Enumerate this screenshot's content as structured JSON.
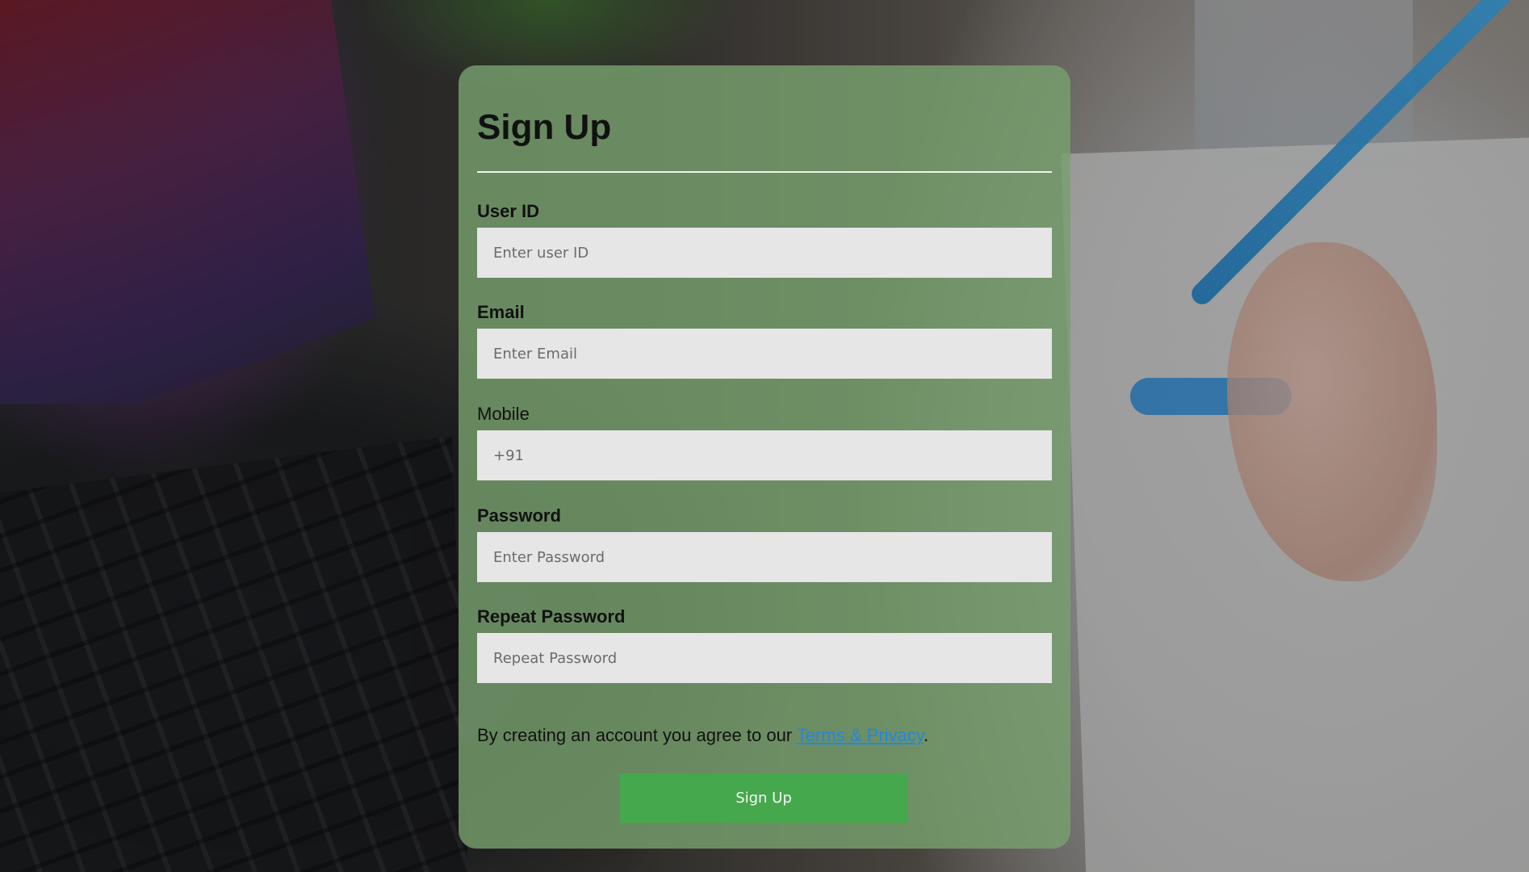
{
  "form": {
    "title": "Sign Up",
    "fields": [
      {
        "label": "User ID",
        "placeholder": "Enter user ID",
        "value": ""
      },
      {
        "label": "Email",
        "placeholder": "Enter Email",
        "value": ""
      },
      {
        "label": "Mobile",
        "placeholder": "+91",
        "value": ""
      },
      {
        "label": "Password",
        "placeholder": "Enter Password",
        "value": ""
      },
      {
        "label": "Repeat Password",
        "placeholder": "Repeat Password",
        "value": ""
      }
    ],
    "terms_text": "By creating an account you agree to our ",
    "terms_link": "Terms & Privacy",
    "terms_suffix": ".",
    "submit_label": "Sign Up"
  },
  "colors": {
    "card": "#78a06e",
    "input_bg": "#e6e6e6",
    "button": "#46a84d",
    "link": "#1e88e5"
  }
}
